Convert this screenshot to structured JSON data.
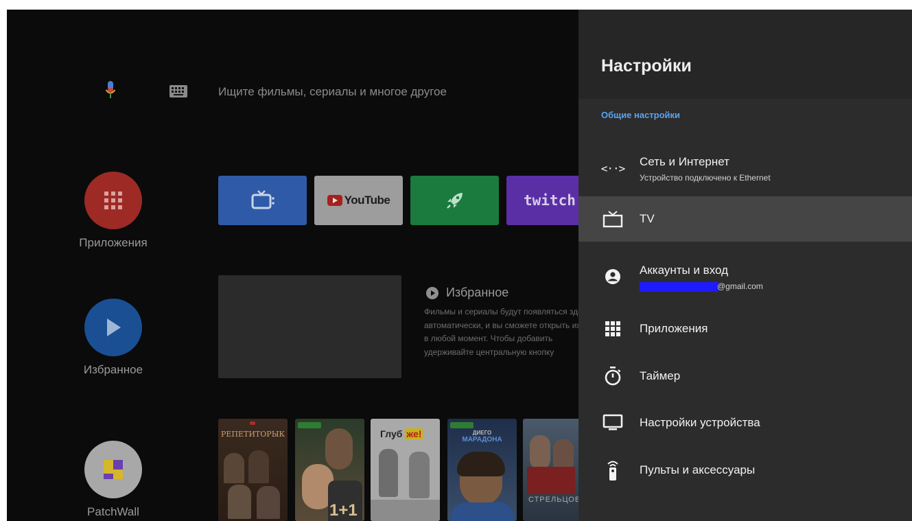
{
  "search": {
    "placeholder": "Ищите фильмы, сериалы и многое другое"
  },
  "sidebar": {
    "items": [
      {
        "label": "Приложения",
        "icon": "apps-grid-icon",
        "color": "#d32f2f"
      },
      {
        "label": "Избранное",
        "icon": "play-icon",
        "color": "#1565c0"
      },
      {
        "label": "PatchWall",
        "icon": "patchwall-icon",
        "color": "#e0e0e0"
      }
    ]
  },
  "apps_row": [
    {
      "name": "Live TV",
      "icon": "tv-icon",
      "color": "#3f7be8"
    },
    {
      "name": "YouTube",
      "label": "YouTube",
      "color": "#d6d6d6"
    },
    {
      "name": "Launcher",
      "icon": "rocket-icon",
      "color": "#23a34a"
    },
    {
      "name": "Twitch",
      "label": "twitch",
      "color": "#7b3fe4"
    }
  ],
  "favorites": {
    "title": "Избранное",
    "description_lines": [
      "Фильмы и сериалы будут появляться здесь",
      "автоматически, и вы сможете открыть их",
      "в любой момент. Чтобы добавить",
      "удерживайте центральную кнопку"
    ]
  },
  "posters": [
    {
      "title": "РЕПЕТИТОРЫК",
      "color": "#4a3a2a"
    },
    {
      "title": "1+1",
      "color": "#6f5a44"
    },
    {
      "title_a": "Глуб",
      "title_b": "же!",
      "color": "#cfcfcf"
    },
    {
      "title_a": "ДИЕГО",
      "title_b": "МАРАДОНА",
      "color": "#2f4f7f"
    },
    {
      "title": "СТРЕЛЬЦОВ",
      "color": "#3b4a5a"
    }
  ],
  "settings": {
    "title": "Настройки",
    "section": "Общие настройки",
    "items": [
      {
        "label": "Сеть и Интернет",
        "sub": "Устройство подключено к Ethernet",
        "icon": "network-icon"
      },
      {
        "label": "TV",
        "icon": "tv-outline-icon",
        "selected": true
      },
      {
        "label": "Аккаунты и вход",
        "sub": "@gmail.com",
        "icon": "account-icon"
      },
      {
        "label": "Приложения",
        "icon": "apps-grid-icon"
      },
      {
        "label": "Таймер",
        "icon": "timer-icon"
      },
      {
        "label": "Настройки устройства",
        "icon": "monitor-icon"
      },
      {
        "label": "Пульты и аксессуары",
        "icon": "remote-icon"
      }
    ]
  }
}
